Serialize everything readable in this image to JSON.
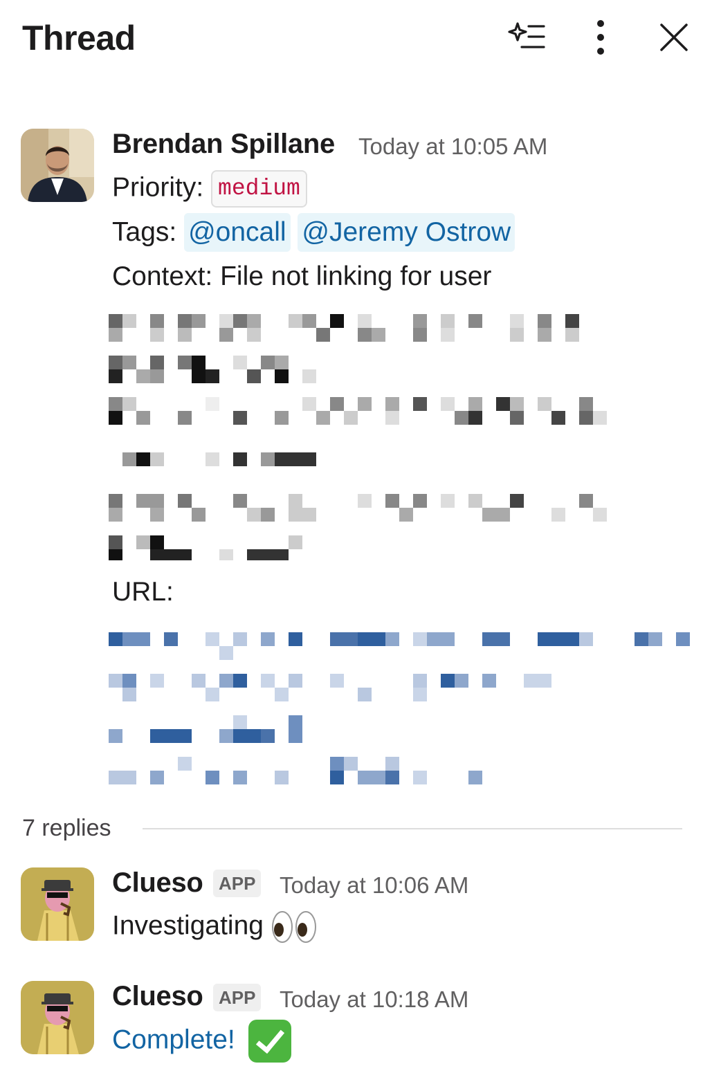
{
  "header": {
    "title": "Thread",
    "actions": [
      "ai-summarize-icon",
      "more-vertical-icon",
      "close-icon"
    ]
  },
  "parent_message": {
    "author": "Brendan Spillane",
    "timestamp": "Today at 10:05 AM",
    "priority_label": "Priority:",
    "priority_value": "medium",
    "tags_label": "Tags:",
    "tags": [
      "@oncall",
      "@Jeremy Ostrow"
    ],
    "context": "Context: File not linking for user",
    "url_label": "URL:"
  },
  "replies": {
    "count_label": "7 replies",
    "items": [
      {
        "author": "Clueso",
        "badge": "APP",
        "timestamp": "Today at 10:06 AM",
        "text": "Investigating",
        "emoji": "eyes"
      },
      {
        "author": "Clueso",
        "badge": "APP",
        "timestamp": "Today at 10:18 AM",
        "text": "Complete!",
        "emoji": "white-check-mark"
      }
    ]
  },
  "colors": {
    "mention": "#1264a3",
    "mention_bg": "#e8f5fa",
    "code_text": "#c01343",
    "check_green": "#4cb53f"
  }
}
